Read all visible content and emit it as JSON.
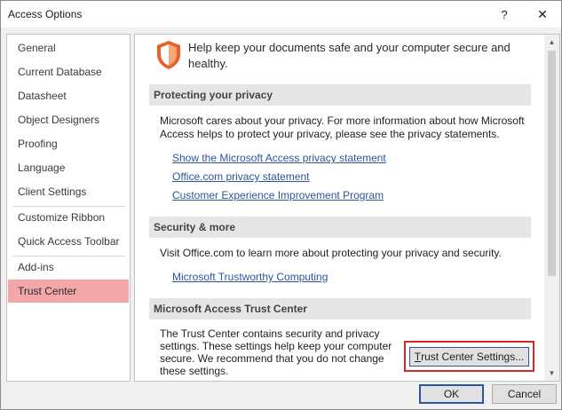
{
  "window": {
    "title": "Access Options",
    "help_label": "?",
    "close_label": "✕"
  },
  "sidebar": {
    "items": [
      {
        "label": "General"
      },
      {
        "label": "Current Database"
      },
      {
        "label": "Datasheet"
      },
      {
        "label": "Object Designers"
      },
      {
        "label": "Proofing"
      },
      {
        "label": "Language"
      },
      {
        "label": "Client Settings"
      },
      {
        "label": "Customize Ribbon"
      },
      {
        "label": "Quick Access Toolbar"
      },
      {
        "label": "Add-ins"
      },
      {
        "label": "Trust Center"
      }
    ],
    "selected": "Trust Center",
    "selected_color": "#f4a7a9"
  },
  "main": {
    "intro": "Help keep your documents safe and your computer secure and healthy.",
    "privacy": {
      "header": "Protecting your privacy",
      "text": "Microsoft cares about your privacy. For more information about how Microsoft Access helps to protect your privacy, please see the privacy statements.",
      "links": [
        "Show the Microsoft Access privacy statement",
        "Office.com privacy statement",
        "Customer Experience Improvement Program"
      ]
    },
    "security": {
      "header": "Security & more",
      "text": "Visit Office.com to learn more about protecting your privacy and security.",
      "link": "Microsoft Trustworthy Computing"
    },
    "trust_center": {
      "header": "Microsoft Access Trust Center",
      "text": "The Trust Center contains security and privacy settings. These settings help keep your computer secure. We recommend that you do not change these settings.",
      "button_mnemonic": "T",
      "button_rest": "rust Center Settings...",
      "highlight_color": "#d62828"
    }
  },
  "footer": {
    "ok_label": "OK",
    "cancel_label": "Cancel"
  },
  "icons": {
    "shield": "shield-icon",
    "scroll_up": "scroll-up-arrow-icon",
    "scroll_down": "scroll-down-arrow-icon"
  },
  "colors": {
    "accent": "#2b579a",
    "shield": "#e8612c"
  }
}
